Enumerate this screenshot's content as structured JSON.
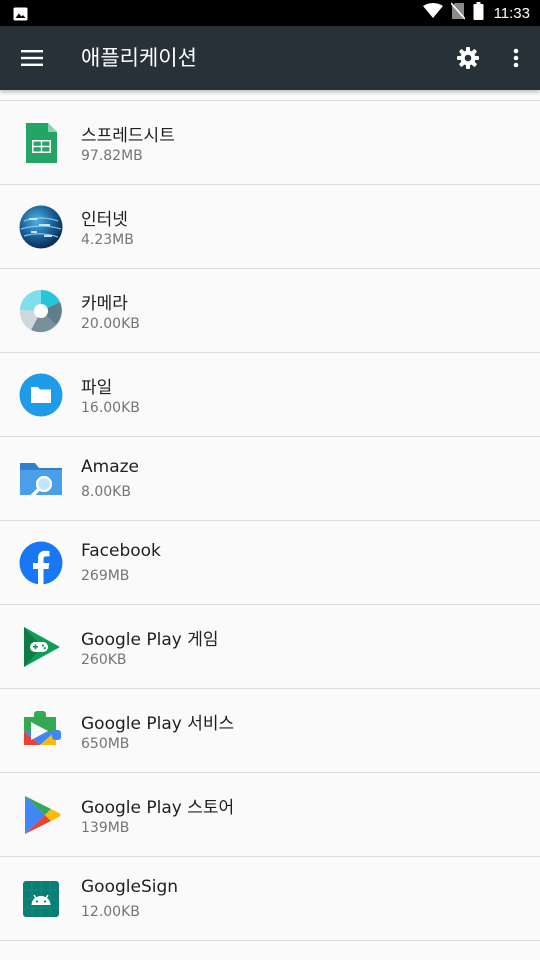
{
  "status_bar": {
    "time": "11:33",
    "icons": [
      "image-notification-icon",
      "wifi-icon",
      "no-sim-icon",
      "battery-icon"
    ]
  },
  "app_bar": {
    "title": "애플리케이션",
    "icons": [
      "menu-icon",
      "settings-gear-icon",
      "more-vert-icon"
    ],
    "background": "#263238"
  },
  "apps": [
    {
      "name": "스프레드시트",
      "size": "97.82MB",
      "icon": "sheets-icon"
    },
    {
      "name": "인터넷",
      "size": "4.23MB",
      "icon": "internet-globe-icon"
    },
    {
      "name": "카메라",
      "size": "20.00KB",
      "icon": "camera-aperture-icon"
    },
    {
      "name": "파일",
      "size": "16.00KB",
      "icon": "files-folder-icon"
    },
    {
      "name": "Amaze",
      "size": "8.00KB",
      "icon": "amaze-folder-search-icon"
    },
    {
      "name": "Facebook",
      "size": "269MB",
      "icon": "facebook-icon"
    },
    {
      "name": "Google Play 게임",
      "size": "260KB",
      "icon": "play-games-icon"
    },
    {
      "name": "Google Play 서비스",
      "size": "650MB",
      "icon": "play-services-icon"
    },
    {
      "name": "Google Play 스토어",
      "size": "139MB",
      "icon": "play-store-icon"
    },
    {
      "name": "GoogleSign",
      "size": "12.00KB",
      "icon": "android-app-icon"
    }
  ]
}
